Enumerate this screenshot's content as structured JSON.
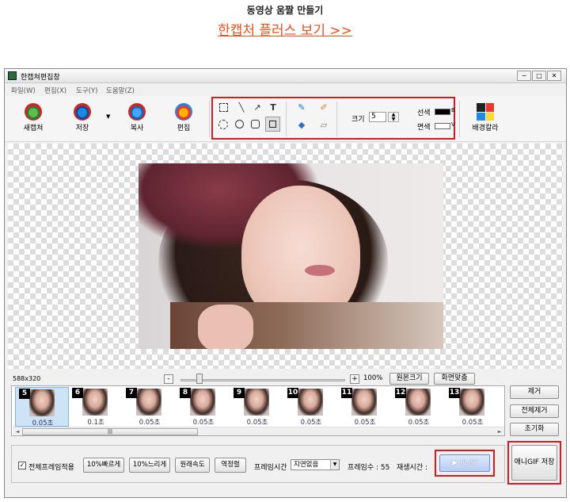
{
  "header": {
    "title": "동영상 움짤 만들기",
    "link": "한캡처 플러스 보기 >>"
  },
  "window": {
    "title": "한캡쳐편집창",
    "controls": [
      "─",
      "□",
      "✕"
    ]
  },
  "menu": [
    "파일(W)",
    "편집(X)",
    "도구(Y)",
    "도움말(Z)"
  ],
  "toolbar": {
    "new_capture": "새캡쳐",
    "save": "저장",
    "copy": "복사",
    "edit": "편집",
    "size_label": "크기",
    "size_value": "5",
    "line_color_label": "선색",
    "line_color_key": "B",
    "fill_color_label": "면색",
    "fill_color_key": "V",
    "bg_color": "배경칼라"
  },
  "canvas": {
    "dimensions": "588x320"
  },
  "zoom": {
    "minus": "-",
    "plus": "+",
    "percent": "100%",
    "original": "원본크기",
    "fit": "화면맞춤",
    "level": 0.1
  },
  "frames": [
    {
      "num": "5",
      "time": "0.05초",
      "selected": true
    },
    {
      "num": "6",
      "time": "0.1초"
    },
    {
      "num": "7",
      "time": "0.05초"
    },
    {
      "num": "8",
      "time": "0.05초"
    },
    {
      "num": "9",
      "time": "0.05초"
    },
    {
      "num": "10",
      "time": "0.05초"
    },
    {
      "num": "11",
      "time": "0.05초"
    },
    {
      "num": "12",
      "time": "0.05초"
    },
    {
      "num": "13",
      "time": "0.05초"
    }
  ],
  "side": {
    "remove": "제거",
    "remove_all": "전체제거",
    "reset": "초기화"
  },
  "bottom": {
    "apply_all": "전체프레임적용",
    "faster": "10%빠르게",
    "slower": "10%느리게",
    "original_speed": "원래속도",
    "reverse": "역정렬",
    "frame_time_label": "프레임시간",
    "frame_time_value": "지연없음",
    "frame_count": "프레임수 : 55",
    "play_time": "재생시간 :",
    "play": "▶ PLAY",
    "save_gif": "애니GIF 저장"
  },
  "colors": {
    "accent_red": "#d71920",
    "link_orange": "#e8501e"
  }
}
